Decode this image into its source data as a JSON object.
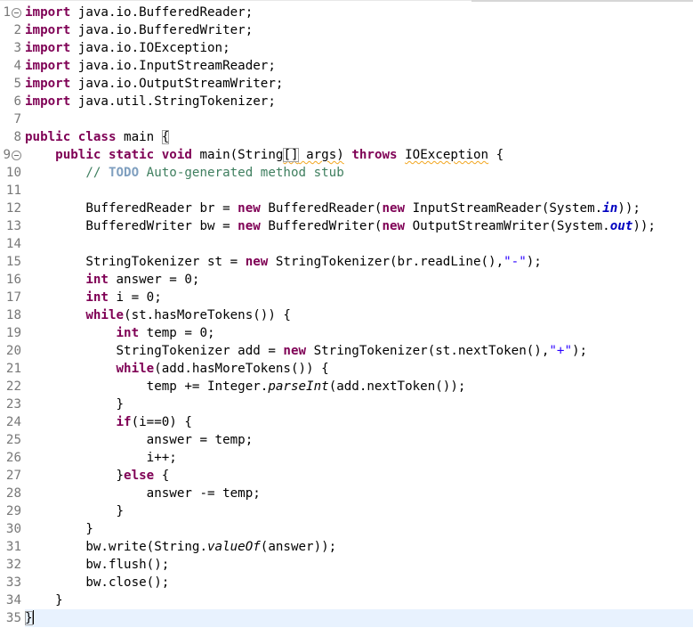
{
  "editor": {
    "current_line": 35,
    "lines": [
      {
        "n": "1",
        "fold": true,
        "segs": [
          [
            "kw",
            "import"
          ],
          [
            "t",
            " java.io.BufferedReader;"
          ]
        ]
      },
      {
        "n": "2",
        "segs": [
          [
            "kw",
            "import"
          ],
          [
            "t",
            " java.io.BufferedWriter;"
          ]
        ]
      },
      {
        "n": "3",
        "segs": [
          [
            "kw",
            "import"
          ],
          [
            "t",
            " java.io.IOException;"
          ]
        ]
      },
      {
        "n": "4",
        "segs": [
          [
            "kw",
            "import"
          ],
          [
            "t",
            " java.io.InputStreamReader;"
          ]
        ]
      },
      {
        "n": "5",
        "segs": [
          [
            "kw",
            "import"
          ],
          [
            "t",
            " java.io.OutputStreamWriter;"
          ]
        ]
      },
      {
        "n": "6",
        "segs": [
          [
            "kw",
            "import"
          ],
          [
            "t",
            " java.util.StringTokenizer;"
          ]
        ]
      },
      {
        "n": "7",
        "segs": []
      },
      {
        "n": "8",
        "segs": [
          [
            "kw",
            "public"
          ],
          [
            "t",
            " "
          ],
          [
            "kw",
            "class"
          ],
          [
            "t",
            " main "
          ],
          [
            "box",
            "{"
          ]
        ]
      },
      {
        "n": "9",
        "fold": true,
        "segs": [
          [
            "t",
            "    "
          ],
          [
            "kw",
            "public"
          ],
          [
            "t",
            " "
          ],
          [
            "kw",
            "static"
          ],
          [
            "t",
            " "
          ],
          [
            "kw",
            "void"
          ],
          [
            "t",
            " main(String"
          ],
          [
            "warnbox",
            "[]"
          ],
          [
            "warn",
            " args)"
          ],
          [
            "t",
            " "
          ],
          [
            "kw",
            "throws"
          ],
          [
            "t",
            " "
          ],
          [
            "warn",
            "IOException"
          ],
          [
            "t",
            " {"
          ]
        ]
      },
      {
        "n": "10",
        "segs": [
          [
            "t",
            "        "
          ],
          [
            "cm",
            "// "
          ],
          [
            "todo",
            "TODO"
          ],
          [
            "cm",
            " Auto-generated method stub"
          ]
        ]
      },
      {
        "n": "11",
        "segs": []
      },
      {
        "n": "12",
        "segs": [
          [
            "t",
            "        BufferedReader br = "
          ],
          [
            "kw",
            "new"
          ],
          [
            "t",
            " BufferedReader("
          ],
          [
            "kw",
            "new"
          ],
          [
            "t",
            " InputStreamReader(System."
          ],
          [
            "fld",
            "in"
          ],
          [
            "t",
            "));"
          ]
        ]
      },
      {
        "n": "13",
        "segs": [
          [
            "t",
            "        BufferedWriter bw = "
          ],
          [
            "kw",
            "new"
          ],
          [
            "t",
            " BufferedWriter("
          ],
          [
            "kw",
            "new"
          ],
          [
            "t",
            " OutputStreamWriter(System."
          ],
          [
            "fld",
            "out"
          ],
          [
            "t",
            "));"
          ]
        ]
      },
      {
        "n": "14",
        "segs": []
      },
      {
        "n": "15",
        "segs": [
          [
            "t",
            "        StringTokenizer st = "
          ],
          [
            "kw",
            "new"
          ],
          [
            "t",
            " StringTokenizer(br.readLine(),"
          ],
          [
            "str",
            "\"-\""
          ],
          [
            "t",
            ");"
          ]
        ]
      },
      {
        "n": "16",
        "segs": [
          [
            "t",
            "        "
          ],
          [
            "kw",
            "int"
          ],
          [
            "t",
            " answer = 0;"
          ]
        ]
      },
      {
        "n": "17",
        "segs": [
          [
            "t",
            "        "
          ],
          [
            "kw",
            "int"
          ],
          [
            "t",
            " i = 0;"
          ]
        ]
      },
      {
        "n": "18",
        "segs": [
          [
            "t",
            "        "
          ],
          [
            "kw",
            "while"
          ],
          [
            "t",
            "(st.hasMoreTokens()) {"
          ]
        ]
      },
      {
        "n": "19",
        "segs": [
          [
            "t",
            "            "
          ],
          [
            "kw",
            "int"
          ],
          [
            "t",
            " temp = 0;"
          ]
        ]
      },
      {
        "n": "20",
        "segs": [
          [
            "t",
            "            StringTokenizer add = "
          ],
          [
            "kw",
            "new"
          ],
          [
            "t",
            " StringTokenizer(st.nextToken(),"
          ],
          [
            "str",
            "\"+\""
          ],
          [
            "t",
            ");"
          ]
        ]
      },
      {
        "n": "21",
        "segs": [
          [
            "t",
            "            "
          ],
          [
            "kw",
            "while"
          ],
          [
            "t",
            "(add.hasMoreTokens()) {"
          ]
        ]
      },
      {
        "n": "22",
        "segs": [
          [
            "t",
            "                temp += Integer."
          ],
          [
            "it",
            "parseInt"
          ],
          [
            "t",
            "(add.nextToken());"
          ]
        ]
      },
      {
        "n": "23",
        "segs": [
          [
            "t",
            "            }"
          ]
        ]
      },
      {
        "n": "24",
        "segs": [
          [
            "t",
            "            "
          ],
          [
            "kw",
            "if"
          ],
          [
            "t",
            "(i==0) {"
          ]
        ]
      },
      {
        "n": "25",
        "segs": [
          [
            "t",
            "                answer = temp;"
          ]
        ]
      },
      {
        "n": "26",
        "segs": [
          [
            "t",
            "                i++;"
          ]
        ]
      },
      {
        "n": "27",
        "segs": [
          [
            "t",
            "            }"
          ],
          [
            "kw",
            "else"
          ],
          [
            "t",
            " {"
          ]
        ]
      },
      {
        "n": "28",
        "segs": [
          [
            "t",
            "                answer -= temp;"
          ]
        ]
      },
      {
        "n": "29",
        "segs": [
          [
            "t",
            "            }"
          ]
        ]
      },
      {
        "n": "30",
        "segs": [
          [
            "t",
            "        }"
          ]
        ]
      },
      {
        "n": "31",
        "segs": [
          [
            "t",
            "        bw.write(String."
          ],
          [
            "it",
            "valueOf"
          ],
          [
            "t",
            "(answer));"
          ]
        ]
      },
      {
        "n": "32",
        "segs": [
          [
            "t",
            "        bw.flush();"
          ]
        ]
      },
      {
        "n": "33",
        "segs": [
          [
            "t",
            "        bw.close();"
          ]
        ]
      },
      {
        "n": "34",
        "segs": [
          [
            "t",
            "    }"
          ]
        ]
      },
      {
        "n": "35",
        "segs": [
          [
            "box",
            "}"
          ],
          [
            "caret",
            ""
          ]
        ]
      }
    ]
  }
}
